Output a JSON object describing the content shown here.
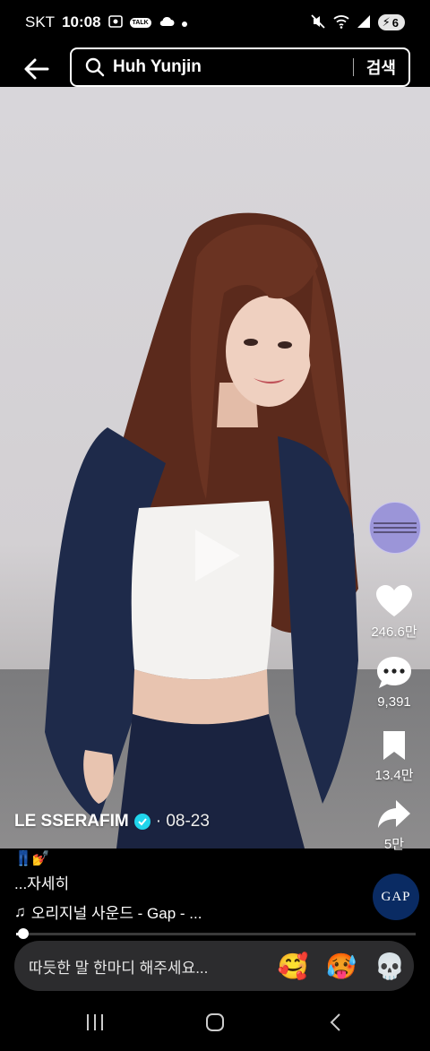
{
  "status_bar": {
    "carrier": "SKT",
    "time": "10:08",
    "talk_badge": "TALK",
    "battery": "6"
  },
  "search": {
    "query": "Huh Yunjin",
    "submit_label": "검색"
  },
  "post": {
    "author": "LE SSERAFIM",
    "date": "· 08-23",
    "emoji_caption": "👖💅",
    "description": "...자세히",
    "music": "오리지널 사운드 - Gap - ...",
    "sponsor_logo": "GAP",
    "progress": 0.02
  },
  "actions": {
    "likes": "246.6만",
    "comments": "9,391",
    "saves": "13.4만",
    "shares": "5만"
  },
  "comment_bar": {
    "placeholder": "따듯한 말 한마디 해주세요...",
    "reactions": [
      "🥰",
      "🥵",
      "💀"
    ]
  },
  "colors": {
    "background": "#000000",
    "verified": "#20d5ec",
    "gap_blue": "#0a2b63"
  },
  "icons": [
    "back-arrow-icon",
    "search-icon",
    "play-icon",
    "heart-icon",
    "comment-icon",
    "bookmark-icon",
    "share-icon",
    "music-note-icon",
    "recents-icon",
    "home-icon",
    "nav-back-icon"
  ]
}
